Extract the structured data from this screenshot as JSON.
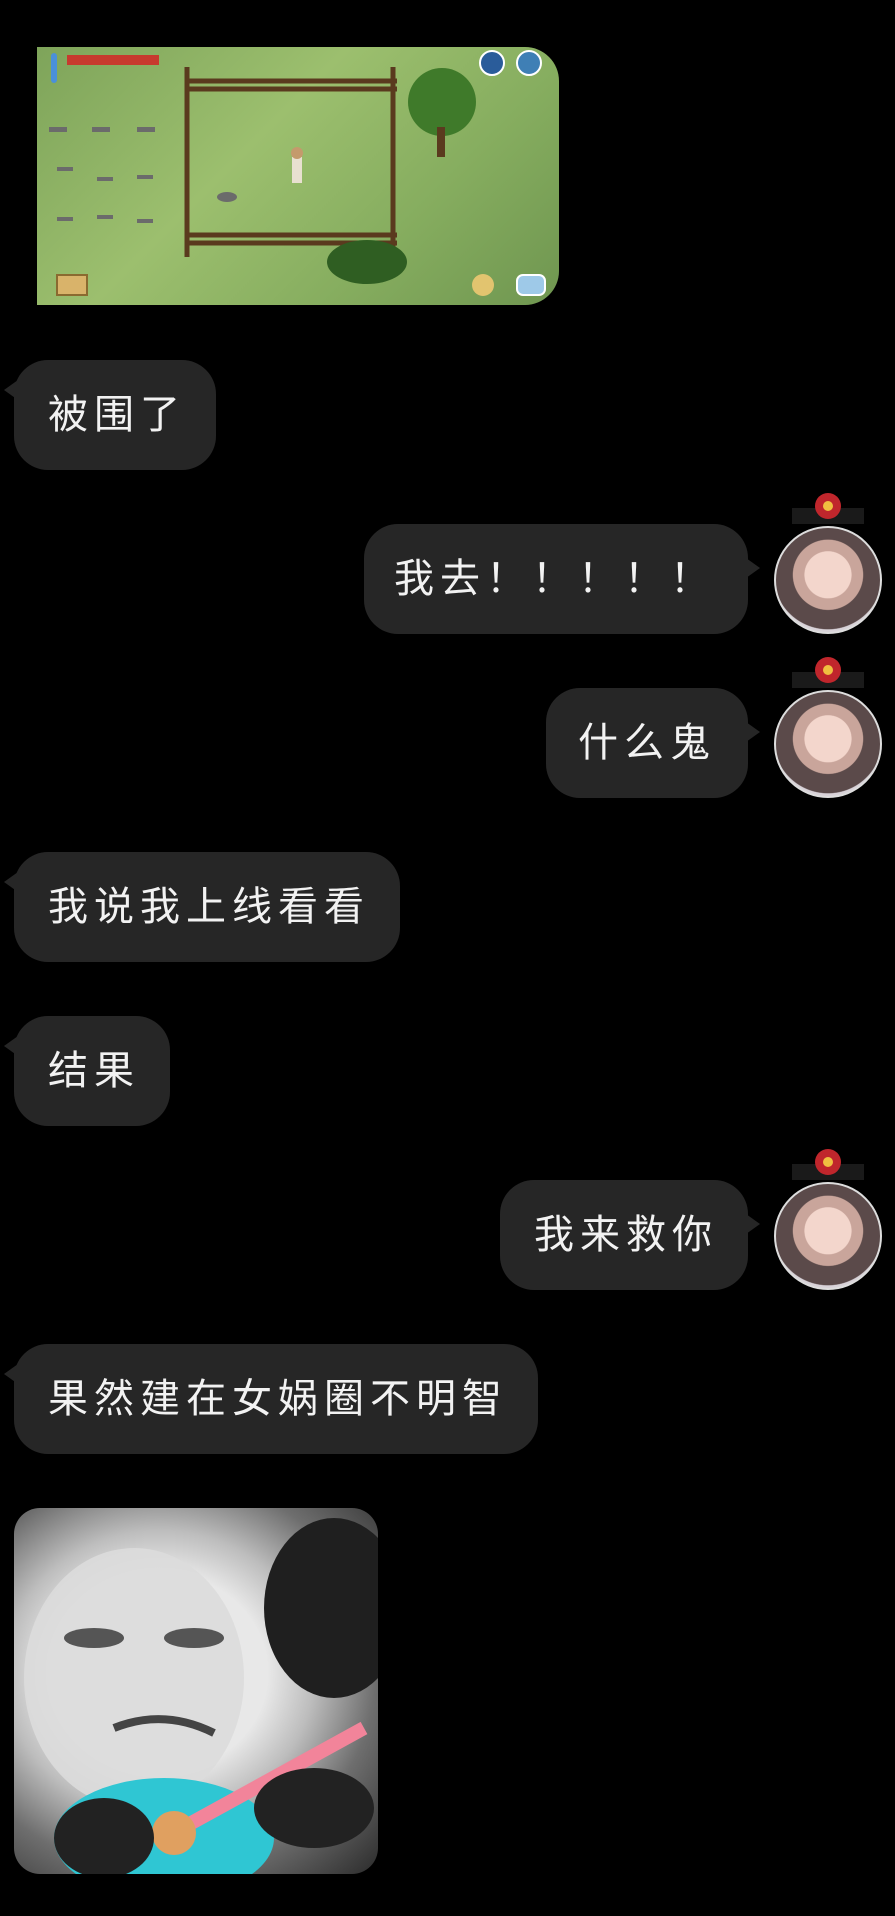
{
  "messages": [
    {
      "side": "left",
      "text": "被围了"
    },
    {
      "side": "right",
      "text": "我去！！！！！"
    },
    {
      "side": "right",
      "text": "什么鬼"
    },
    {
      "side": "left",
      "text": "我说我上线看看"
    },
    {
      "side": "left",
      "text": "结果"
    },
    {
      "side": "right",
      "text": "我来救你"
    },
    {
      "side": "left",
      "text": "果然建在女娲圈不明智"
    }
  ],
  "images": {
    "game_screenshot": "game-screenshot-image",
    "meme": "meme-sticker-image"
  },
  "colors": {
    "background": "#000000",
    "bubble": "#262626",
    "text": "#f2f2f2"
  }
}
